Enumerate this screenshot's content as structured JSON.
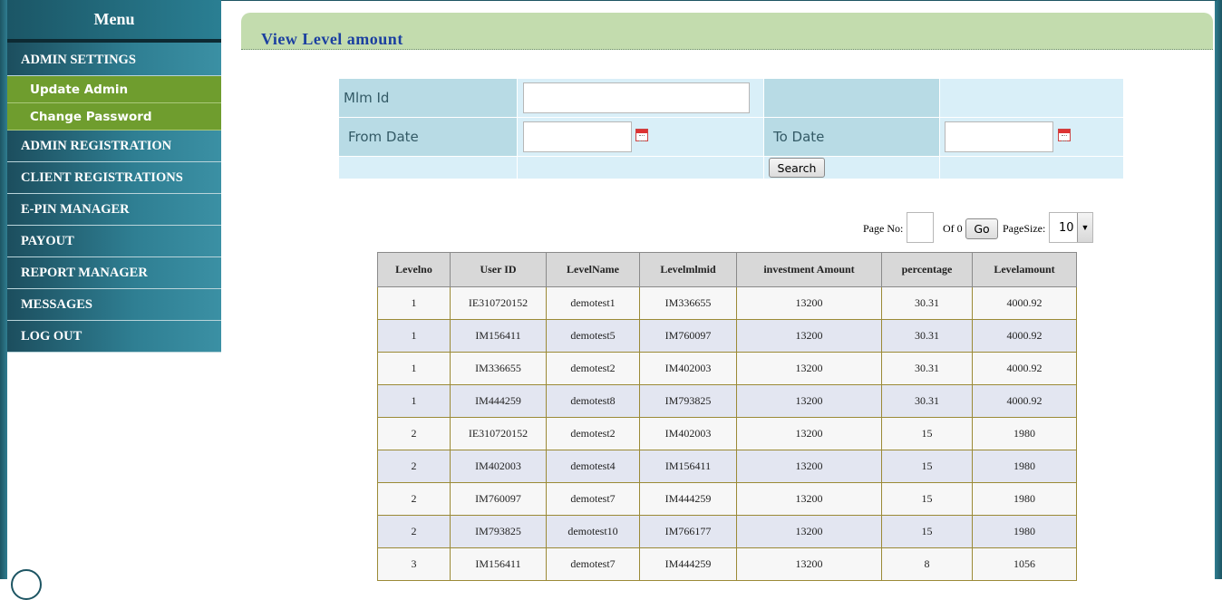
{
  "sidebar": {
    "title": "Menu",
    "items": [
      {
        "label": "ADMIN SETTINGS",
        "sub": [
          "Update Admin",
          "Change Password"
        ]
      },
      {
        "label": "ADMIN REGISTRATION"
      },
      {
        "label": "CLIENT REGISTRATIONS"
      },
      {
        "label": "E-PIN MANAGER"
      },
      {
        "label": "PAYOUT"
      },
      {
        "label": "REPORT MANAGER"
      },
      {
        "label": "MESSAGES"
      },
      {
        "label": "LOG OUT"
      }
    ]
  },
  "page": {
    "title": "View Level amount"
  },
  "form": {
    "mlm_id_label": "Mlm Id",
    "mlm_id_value": "",
    "from_date_label": "From Date",
    "from_date_value": "",
    "to_date_label": "To Date",
    "to_date_value": "",
    "search_label": "Search"
  },
  "pager": {
    "page_no_label": "Page No:",
    "page_no_value": "",
    "of_label": "Of 0",
    "go_label": "Go",
    "page_size_label": "PageSize:",
    "page_size_value": "10"
  },
  "table": {
    "headers": [
      "Levelno",
      "User ID",
      "LevelName",
      "Levelmlmid",
      "investment Amount",
      "percentage",
      "Levelamount"
    ],
    "rows": [
      [
        "1",
        "IE310720152",
        "demotest1",
        "IM336655",
        "13200",
        "30.31",
        "4000.92"
      ],
      [
        "1",
        "IM156411",
        "demotest5",
        "IM760097",
        "13200",
        "30.31",
        "4000.92"
      ],
      [
        "1",
        "IM336655",
        "demotest2",
        "IM402003",
        "13200",
        "30.31",
        "4000.92"
      ],
      [
        "1",
        "IM444259",
        "demotest8",
        "IM793825",
        "13200",
        "30.31",
        "4000.92"
      ],
      [
        "2",
        "IE310720152",
        "demotest2",
        "IM402003",
        "13200",
        "15",
        "1980"
      ],
      [
        "2",
        "IM402003",
        "demotest4",
        "IM156411",
        "13200",
        "15",
        "1980"
      ],
      [
        "2",
        "IM760097",
        "demotest7",
        "IM444259",
        "13200",
        "15",
        "1980"
      ],
      [
        "2",
        "IM793825",
        "demotest10",
        "IM766177",
        "13200",
        "15",
        "1980"
      ],
      [
        "3",
        "IM156411",
        "demotest7",
        "IM444259",
        "13200",
        "8",
        "1056"
      ]
    ]
  },
  "icons": {
    "date_picker": "calendar-icon",
    "dropdown": "chevron-down-icon"
  }
}
